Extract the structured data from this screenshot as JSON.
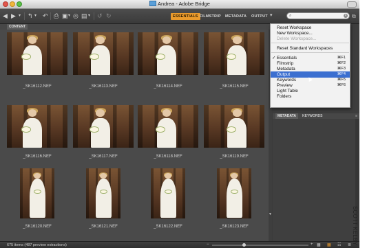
{
  "window": {
    "title": "Andrea - Adobe Bridge"
  },
  "toolbar": {
    "workspaces": [
      "ESSENTIALS",
      "FILMSTRIP",
      "METADATA",
      "OUTPUT"
    ],
    "active_workspace": "ESSENTIALS",
    "search": {
      "placeholder": "",
      "value": ""
    }
  },
  "content": {
    "tab_label": "CONTENT",
    "thumbnails": [
      {
        "file": "_SK16112.NEF",
        "orientation": "landscape"
      },
      {
        "file": "_SK16113.NEF",
        "orientation": "landscape"
      },
      {
        "file": "_SK16114.NEF",
        "orientation": "landscape"
      },
      {
        "file": "_SK16115.NEF",
        "orientation": "landscape"
      },
      {
        "file": "_SK16116.NEF",
        "orientation": "landscape"
      },
      {
        "file": "_SK16117.NEF",
        "orientation": "landscape"
      },
      {
        "file": "_SK16118.NEF",
        "orientation": "landscape"
      },
      {
        "file": "_SK16119.NEF",
        "orientation": "landscape"
      },
      {
        "file": "_SK16120.NEF",
        "orientation": "portrait"
      },
      {
        "file": "_SK16121.NEF",
        "orientation": "portrait"
      },
      {
        "file": "_SK16122.NEF",
        "orientation": "portrait"
      },
      {
        "file": "_SK16123.NEF",
        "orientation": "portrait"
      }
    ]
  },
  "right_panel": {
    "tabs": [
      "METADATA",
      "KEYWORDS"
    ],
    "active_tab": "METADATA"
  },
  "workspace_menu": {
    "items": [
      {
        "label": "Reset Workspace",
        "shortcut": "",
        "checked": false,
        "disabled": false,
        "highlighted": false
      },
      {
        "label": "New Workspace...",
        "shortcut": "",
        "checked": false,
        "disabled": false,
        "highlighted": false
      },
      {
        "label": "Delete Workspace...",
        "shortcut": "",
        "checked": false,
        "disabled": true,
        "highlighted": false
      },
      {
        "separator": true
      },
      {
        "label": "Reset Standard Workspaces",
        "shortcut": "",
        "checked": false,
        "disabled": false,
        "highlighted": false
      },
      {
        "separator": true
      },
      {
        "label": "Essentials",
        "shortcut": "⌘F1",
        "checked": true,
        "disabled": false,
        "highlighted": false
      },
      {
        "label": "Filmstrip",
        "shortcut": "⌘F2",
        "checked": false,
        "disabled": false,
        "highlighted": false
      },
      {
        "label": "Metadata",
        "shortcut": "⌘F3",
        "checked": false,
        "disabled": false,
        "highlighted": false
      },
      {
        "label": "Output",
        "shortcut": "⌘F4",
        "checked": false,
        "disabled": false,
        "highlighted": true
      },
      {
        "label": "Keywords",
        "shortcut": "⌘F5",
        "checked": false,
        "disabled": false,
        "highlighted": false
      },
      {
        "label": "Preview",
        "shortcut": "⌘F6",
        "checked": false,
        "disabled": false,
        "highlighted": false
      },
      {
        "label": "Light Table",
        "shortcut": "",
        "checked": false,
        "disabled": false,
        "highlighted": false
      },
      {
        "label": "Folders",
        "shortcut": "",
        "checked": false,
        "disabled": false,
        "highlighted": false
      }
    ]
  },
  "status_bar": {
    "text": "675 items (487 preview extractions)",
    "thumbnail_size": 0.33
  },
  "credit": "SCOTT KELBY",
  "colors": {
    "accent": "#e99a2c",
    "highlight": "#3b6fd0",
    "panel_bg": "#4a4a4a"
  }
}
